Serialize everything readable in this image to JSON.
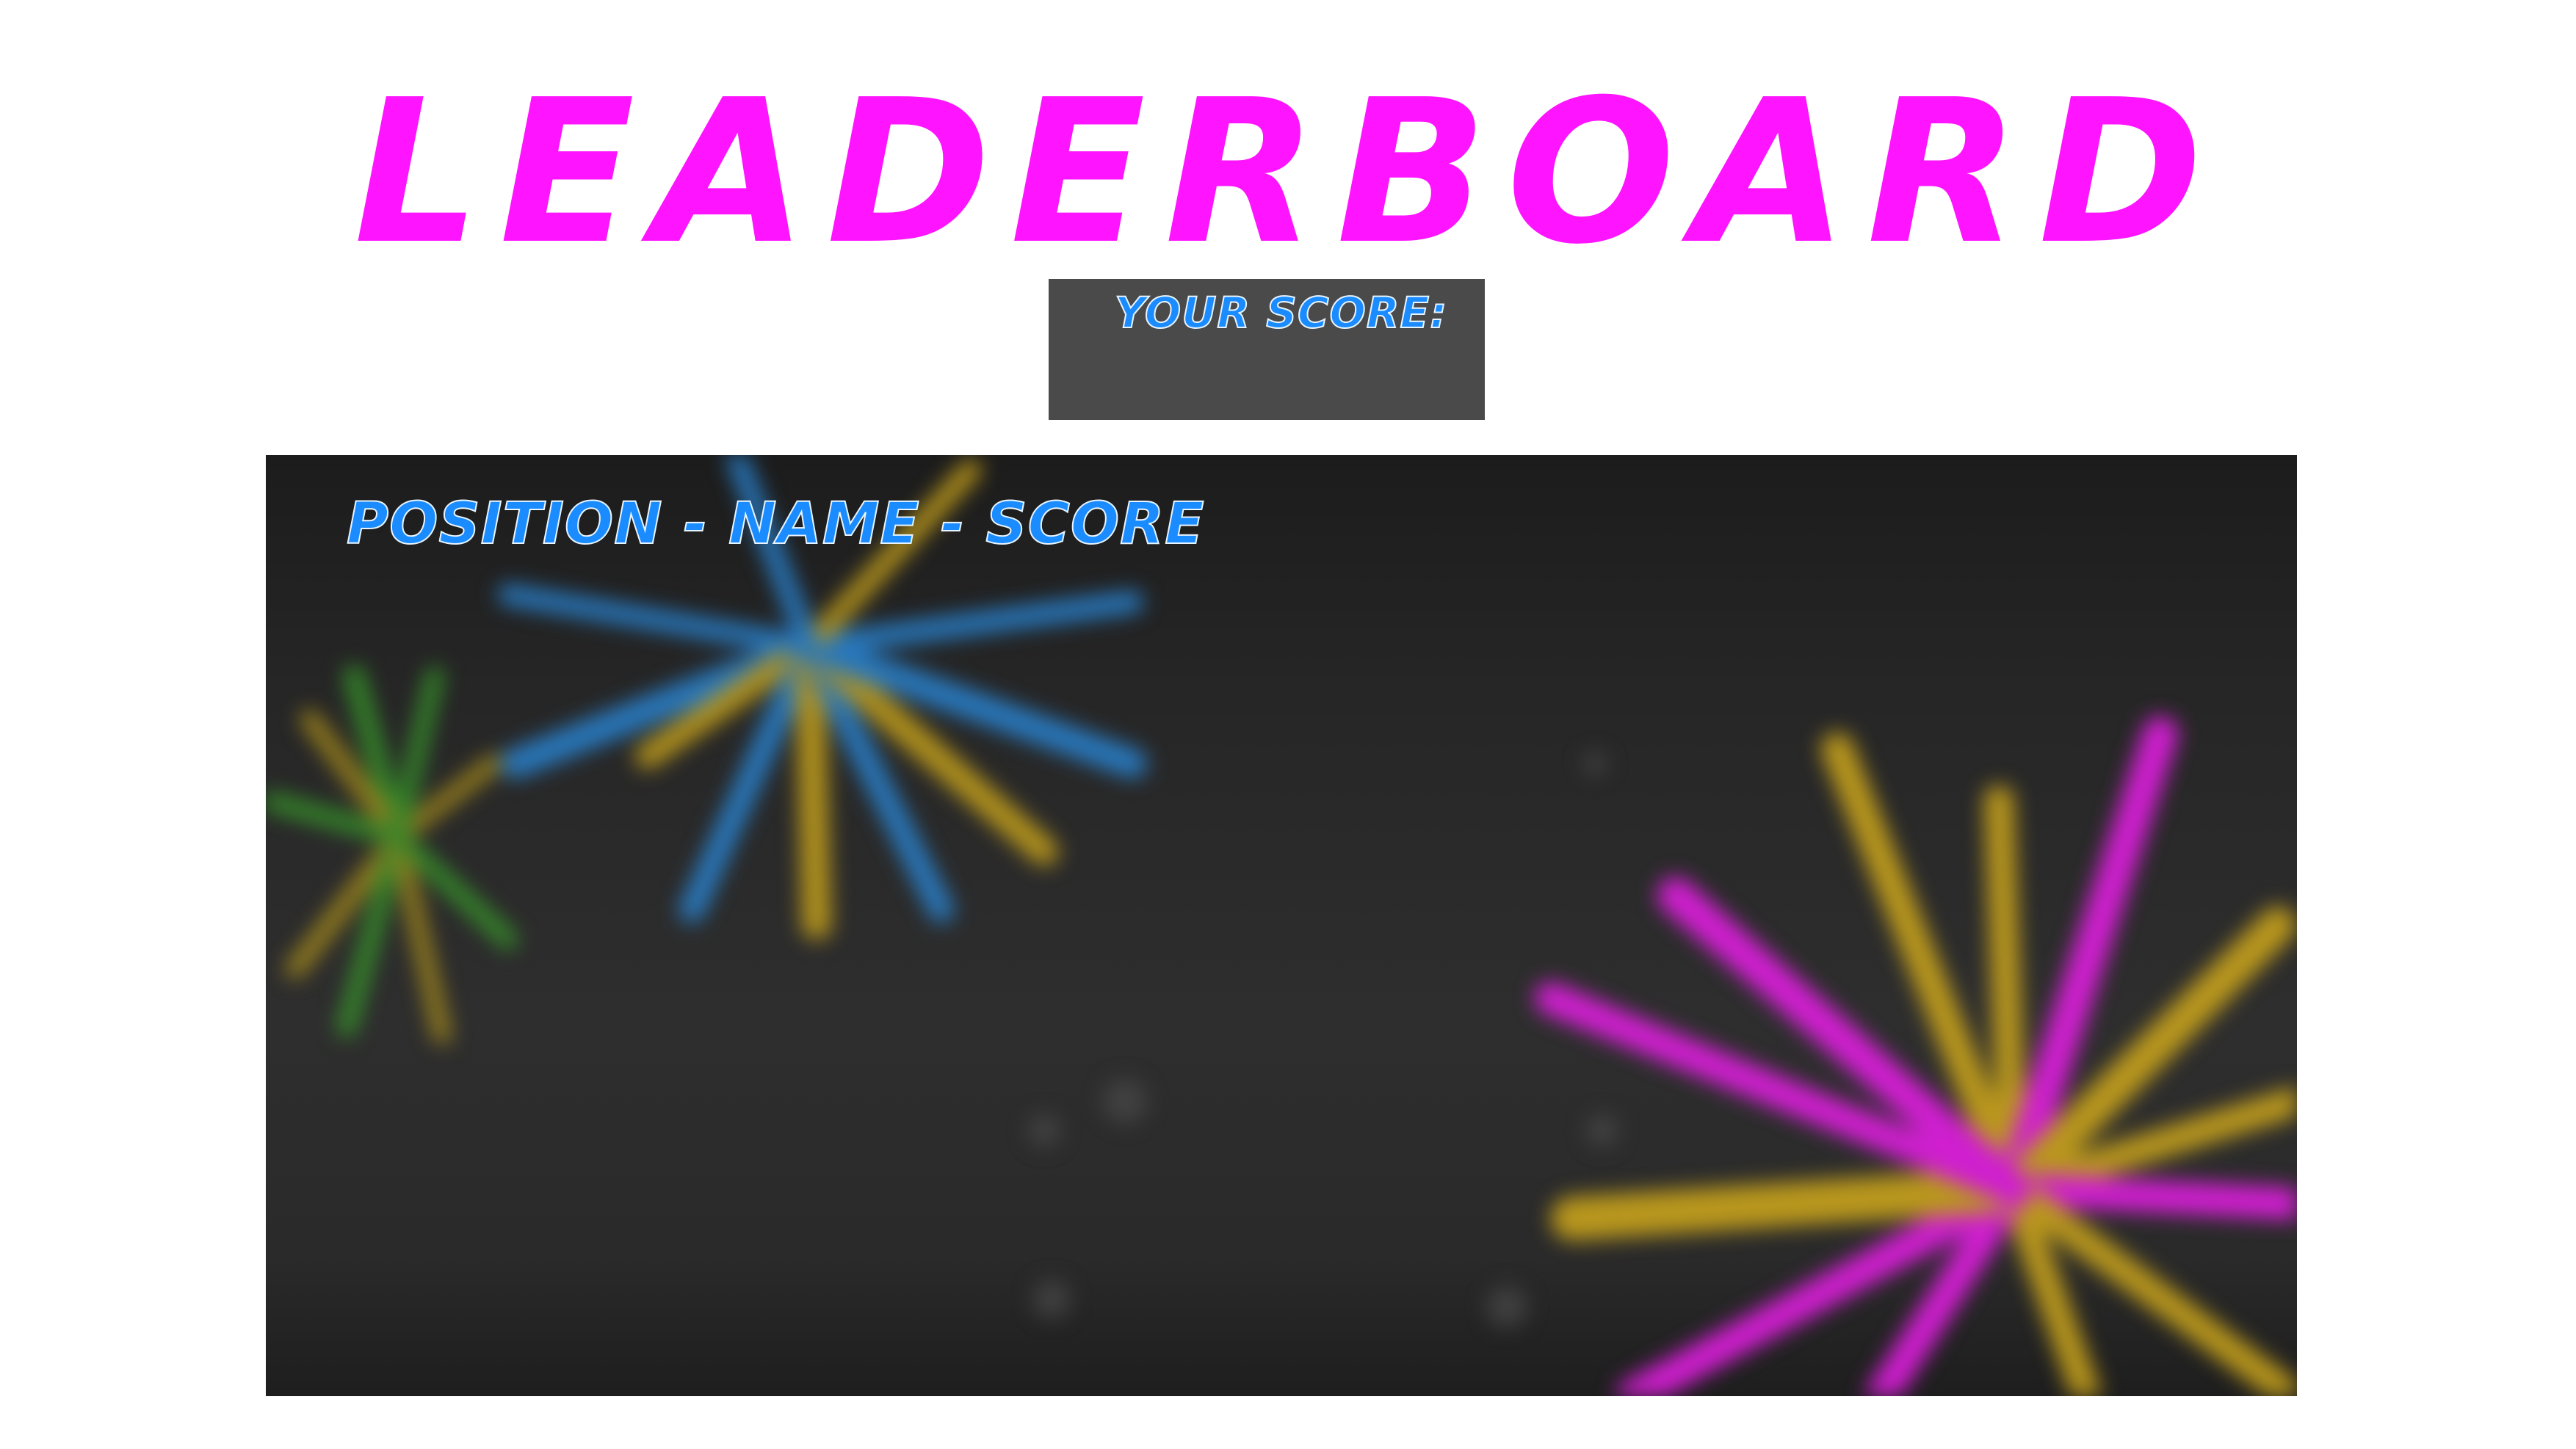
{
  "title": "LEADERBOARD",
  "score_panel": {
    "label": "YOUR SCORE:"
  },
  "board": {
    "header": "POSITION - NAME - SCORE"
  },
  "colors": {
    "title": "#ff14ff",
    "label_text": "#1a8cff",
    "score_box": "#4a4a4a",
    "board_background": "#262626"
  }
}
